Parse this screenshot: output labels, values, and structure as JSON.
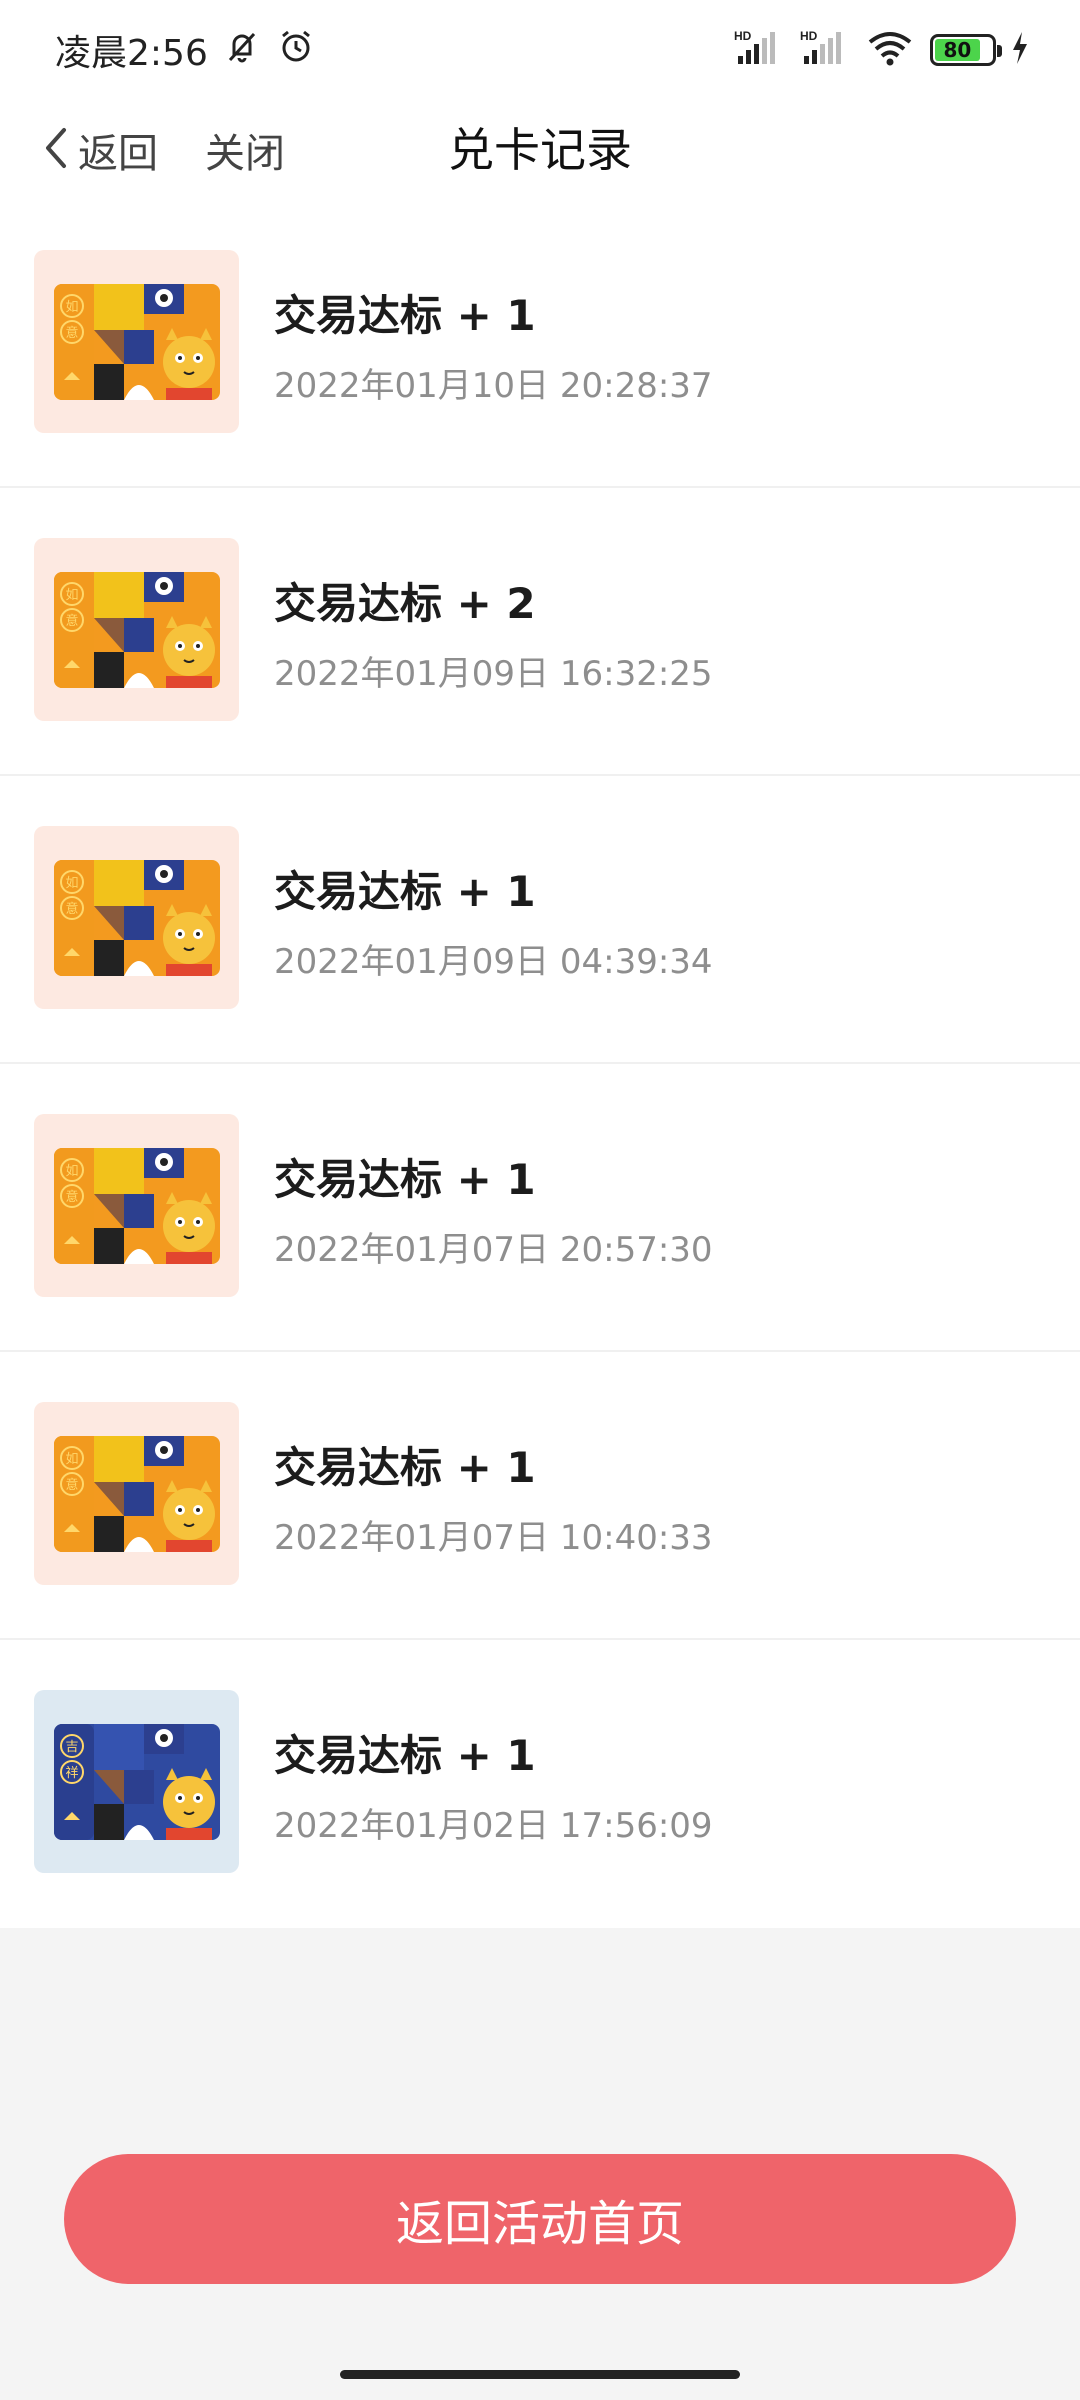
{
  "status_bar": {
    "time": "凌晨2:56",
    "battery": "80",
    "icons": [
      "mute-icon",
      "alarm-icon",
      "signal-hd-icon",
      "signal-hd-icon",
      "wifi-icon",
      "battery-icon",
      "charging-icon"
    ]
  },
  "nav": {
    "back_label": "返回",
    "close_label": "关闭",
    "title": "兑卡记录"
  },
  "records": [
    {
      "title": "交易达标 + 1",
      "time": "2022年01月10日 20:28:37",
      "card": "如意"
    },
    {
      "title": "交易达标 + 2",
      "time": "2022年01月09日 16:32:25",
      "card": "如意"
    },
    {
      "title": "交易达标 + 1",
      "time": "2022年01月09日 04:39:34",
      "card": "如意"
    },
    {
      "title": "交易达标 + 1",
      "time": "2022年01月07日 20:57:30",
      "card": "如意"
    },
    {
      "title": "交易达标 + 1",
      "time": "2022年01月07日 10:40:33",
      "card": "如意"
    },
    {
      "title": "交易达标 + 1",
      "time": "2022年01月02日 17:56:09",
      "card": "吉祥"
    }
  ],
  "footer": {
    "button_label": "返回活动首页"
  },
  "colors": {
    "accent": "#ef646a",
    "card_orange": "#f39a1f",
    "card_blue": "#2f4aa0"
  }
}
